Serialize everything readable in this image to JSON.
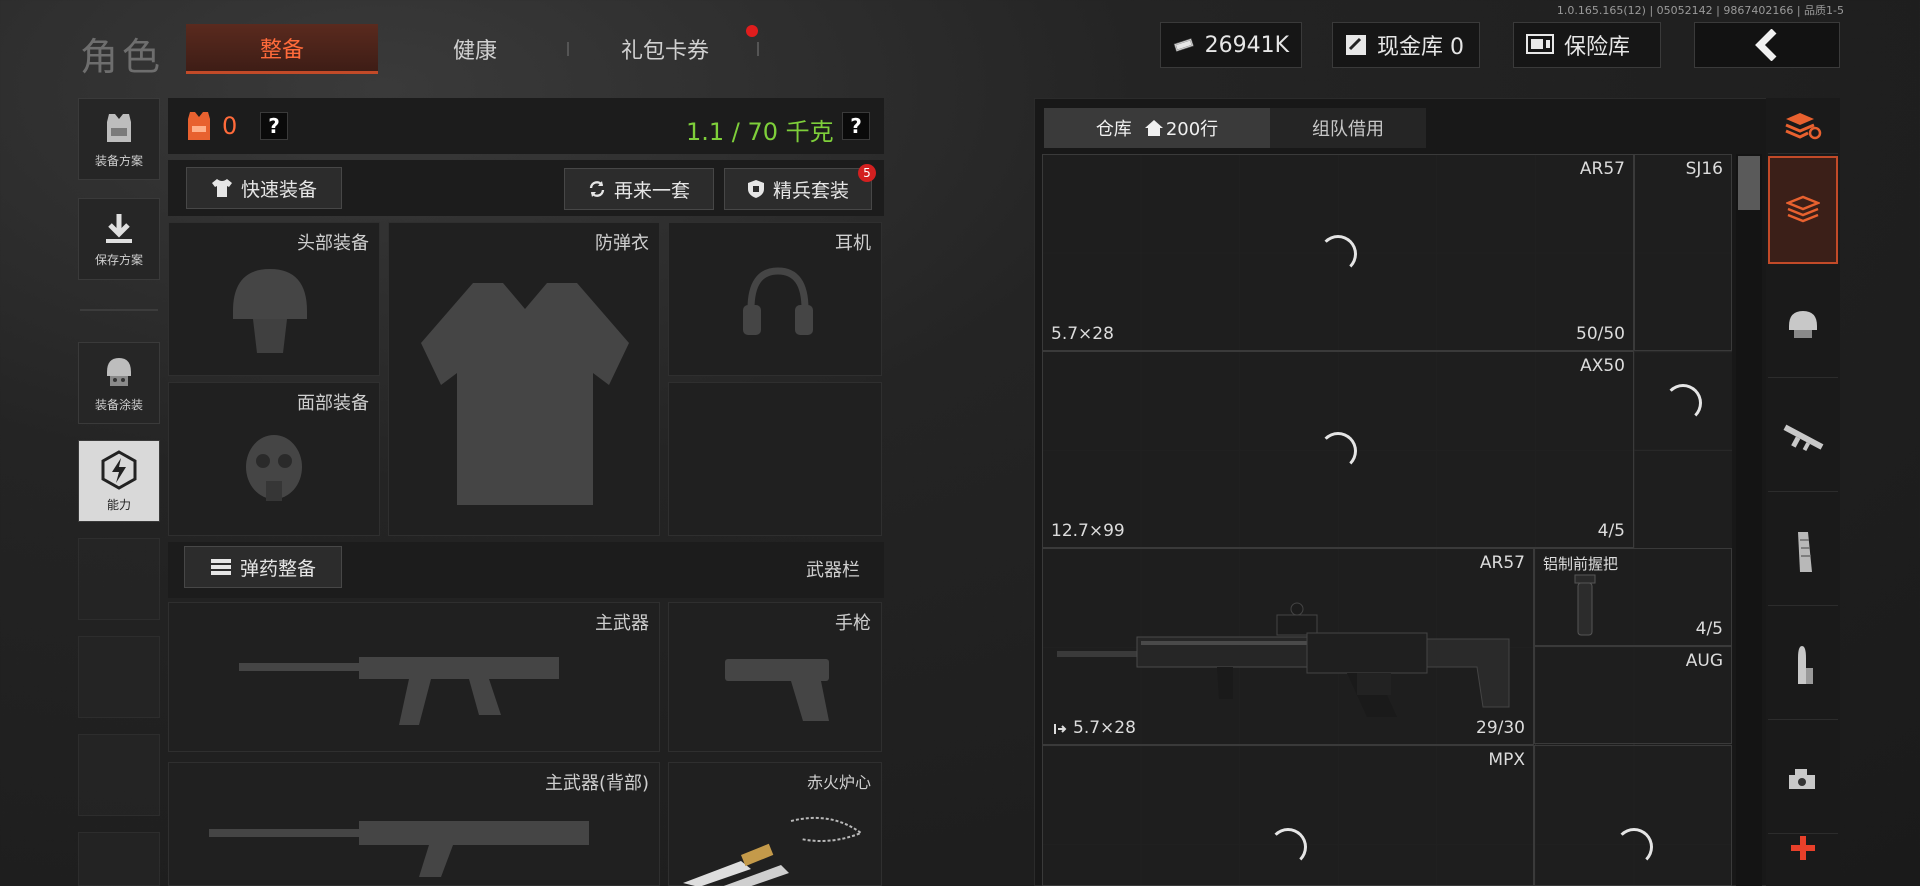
{
  "header": {
    "title": "角色",
    "tabs": [
      {
        "label": "整备",
        "active": true
      },
      {
        "label": "健康",
        "active": false
      },
      {
        "label": "礼包卡券",
        "active": false,
        "has_notification": true
      }
    ],
    "version_info": "1.0.165.165(12) | 05052142 | 9867402166 | 品质1-5",
    "money": {
      "value": "26941K",
      "icon": "cash-icon"
    },
    "cash_vault": {
      "label": "现金库 0",
      "icon": "vault-icon"
    },
    "safe_box": {
      "label": "保险库",
      "icon": "safe-icon"
    },
    "back": {
      "icon": "chevron-left-icon"
    }
  },
  "sidebar": [
    {
      "label": "装备方案",
      "icon": "vest-icon"
    },
    {
      "label": "保存方案",
      "icon": "download-icon"
    },
    {
      "label": "装备涂装",
      "icon": "helmet-icon"
    },
    {
      "label": "能力",
      "icon": "lightning-icon",
      "active": true
    }
  ],
  "equipment": {
    "armor_count": "0",
    "help_mark": "?",
    "weight": "1.1 / 70 千克",
    "buttons": {
      "quick_equip": "快速装备",
      "redo": "再来一套",
      "elite_set": "精兵套装",
      "elite_badge": "5",
      "ammo": "弹药整备"
    },
    "slots": {
      "head": "头部装备",
      "vest": "防弹衣",
      "headset": "耳机",
      "face": "面部装备",
      "weapon_bar": "武器栏",
      "primary": "主武器",
      "pistol": "手枪",
      "primary_back": "主武器(背部)",
      "melee": "赤火炉心"
    }
  },
  "warehouse": {
    "tab_warehouse": "仓库",
    "tab_rows": "200行",
    "tab_team": "组队借用",
    "items": [
      {
        "name": "AR57",
        "caliber": "5.7×28",
        "count": "50/50"
      },
      {
        "name": "SJ16"
      },
      {
        "name": "AX50",
        "caliber": "12.7×99",
        "count": "4/5"
      },
      {
        "name": "AR57",
        "caliber": "5.7×28",
        "count": "29/30"
      },
      {
        "name": "铝制前握把",
        "count": "4/5"
      },
      {
        "name": "AUG"
      },
      {
        "name": "MPX"
      }
    ]
  },
  "filters": [
    {
      "icon": "stack-refresh-icon"
    },
    {
      "icon": "layers-icon",
      "active": true
    },
    {
      "icon": "helmet-icon"
    },
    {
      "icon": "rifle-icon"
    },
    {
      "icon": "magazine-icon"
    },
    {
      "icon": "bullet-icon"
    },
    {
      "icon": "scope-icon"
    },
    {
      "icon": "plus-icon"
    }
  ],
  "colors": {
    "accent": "#ff6a3a",
    "weight_green": "#7ecf3a",
    "badge_red": "#d32020"
  }
}
